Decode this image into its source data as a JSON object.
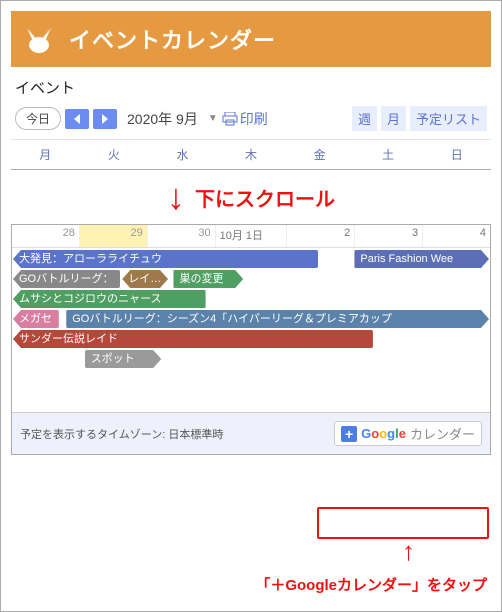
{
  "header": {
    "title": "イベントカレンダー"
  },
  "section_label": "イベント",
  "toolbar": {
    "today": "今日",
    "date": "2020年 9月",
    "print": "印刷",
    "views": {
      "week": "週",
      "month": "月",
      "agenda": "予定リスト"
    }
  },
  "dow": [
    "月",
    "火",
    "水",
    "木",
    "金",
    "土",
    "日"
  ],
  "scroll_hint": "下にスクロール",
  "dates": [
    "28",
    "29",
    "30",
    "10月 1日",
    "2",
    "3",
    "4"
  ],
  "events": [
    {
      "label": "大発見：アローラライチュウ",
      "row": 0,
      "start": 0,
      "end": 4.5,
      "cls": "c-blue tri-l"
    },
    {
      "label": "Paris Fashion Wee",
      "row": 0,
      "start": 5,
      "end": 7,
      "cls": "c-dblue tri-r"
    },
    {
      "label": "GOバトルリーグ：",
      "row": 1,
      "start": 0,
      "end": 1.6,
      "cls": "c-gray tri-l"
    },
    {
      "label": "レイドア",
      "row": 1,
      "start": 1.6,
      "end": 2.3,
      "cls": "c-brown tri-lr"
    },
    {
      "label": "巣の変更",
      "row": 1,
      "start": 2.35,
      "end": 3.4,
      "cls": "c-green tri-r"
    },
    {
      "label": "ムサシとコジロウのニャース",
      "row": 2,
      "start": 0,
      "end": 2.85,
      "cls": "c-green tri-l"
    },
    {
      "label": "メガセ",
      "row": 3,
      "start": 0,
      "end": 0.7,
      "cls": "c-pink tri-l"
    },
    {
      "label": "GOバトルリーグ：シーズン4「ハイパーリーグ＆プレミアカップ",
      "row": 3,
      "start": 0.78,
      "end": 7,
      "cls": "c-aq tri-r"
    },
    {
      "label": "サンダー伝説レイド",
      "row": 4,
      "start": 0,
      "end": 5.3,
      "cls": "c-red tri-l"
    },
    {
      "label": "スポット",
      "row": 5,
      "start": 1.05,
      "end": 2.2,
      "cls": "c-gr2 tri-r"
    }
  ],
  "footer": {
    "tz": "予定を表示するタイムゾーン: 日本標準時",
    "google": {
      "text": "カレンダー"
    }
  },
  "callout": "「＋Googleカレンダー」をタップ"
}
